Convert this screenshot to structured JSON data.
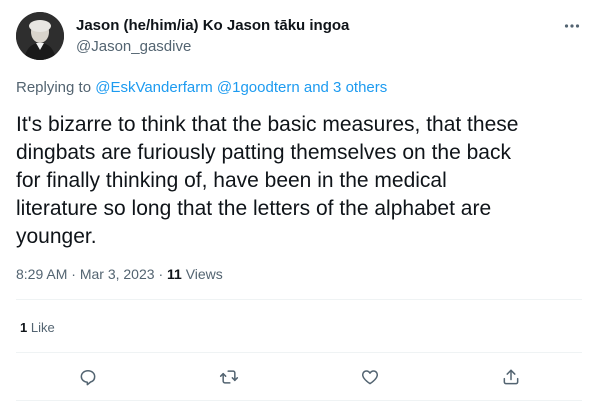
{
  "author": {
    "display_name": "Jason (he/him/ia) Ko Jason tāku ingoa",
    "handle": "@Jason_gasdive"
  },
  "replying": {
    "prefix": "Replying to",
    "mention_1": "@EskVanderfarm",
    "mention_2": "@1goodtern",
    "others": "and 3 others"
  },
  "tweet": {
    "text": "It's bizarre to think that the basic measures, that these\ndingbats are furiously patting themselves on the back\nfor finally thinking of, have been in the medical\nliterature so long that the letters of the alphabet are\nyounger."
  },
  "meta": {
    "time": "8:29 AM",
    "separator": "·",
    "date": "Mar 3, 2023",
    "views_count": "11",
    "views_label": "Views"
  },
  "engagement": {
    "likes_count": "1",
    "likes_label": "Like"
  },
  "icons": {
    "more": "more-icon",
    "reply": "reply-icon",
    "retweet": "retweet-icon",
    "like": "heart-icon",
    "share": "share-icon"
  },
  "colors": {
    "link": "#1d9bf0",
    "secondary_text": "#536471",
    "primary_text": "#0f1419",
    "divider": "#eff3f4"
  }
}
